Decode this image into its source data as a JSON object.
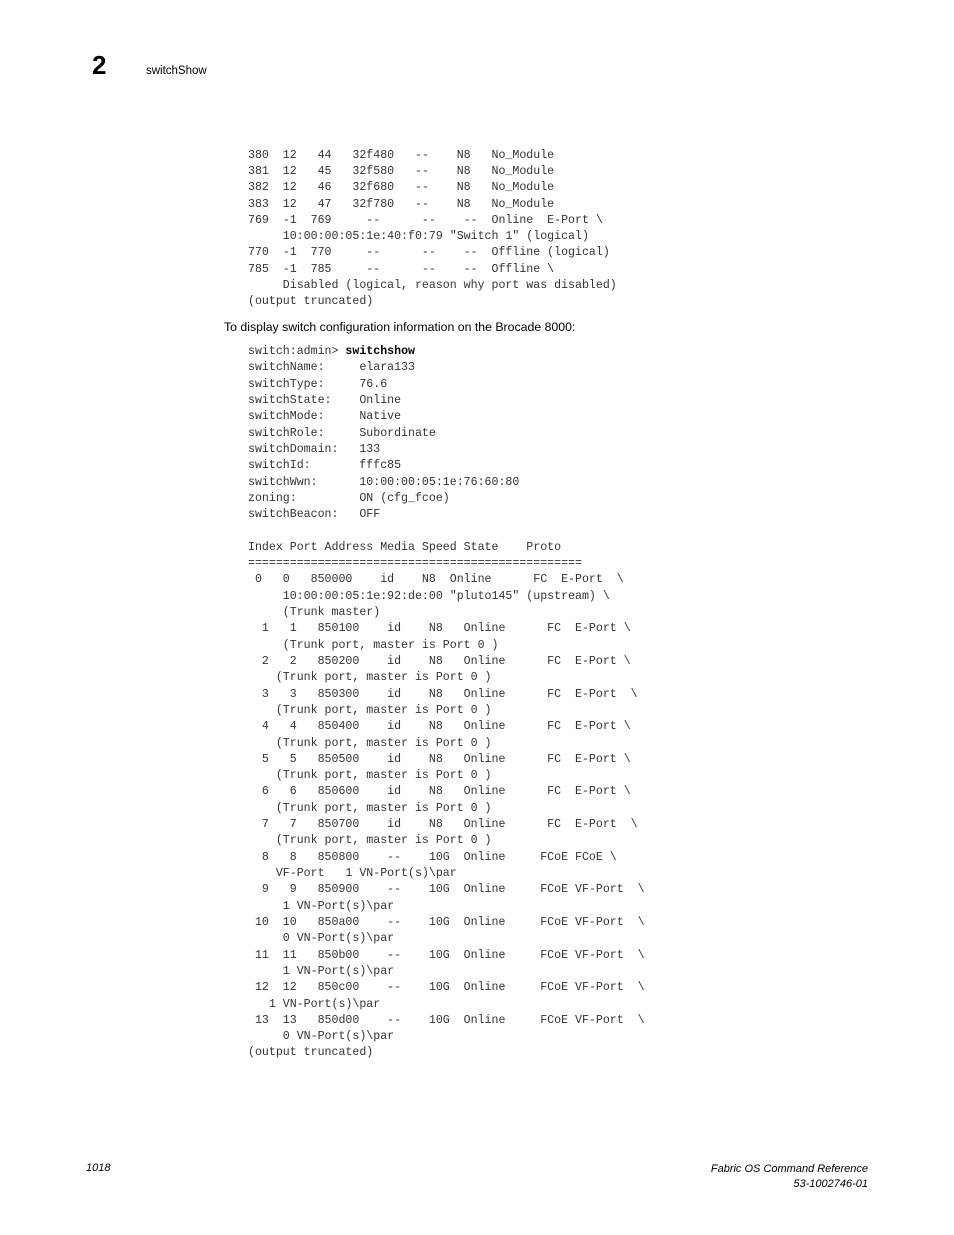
{
  "header": {
    "chapter_number": "2",
    "title": "switchShow"
  },
  "code_top": "380  12   44   32f480   --    N8   No_Module\n381  12   45   32f580   --    N8   No_Module\n382  12   46   32f680   --    N8   No_Module\n383  12   47   32f780   --    N8   No_Module\n769  -1  769     --      --    --  Online  E-Port \\\n     10:00:00:05:1e:40:f0:79 \"Switch 1\" (logical)\n770  -1  770     --      --    --  Offline (logical)\n785  -1  785     --      --    --  Offline \\\n     Disabled (logical, reason why port was disabled)\n(output truncated)",
  "body_paragraph": "To display switch configuration information on the Brocade 8000:",
  "prompt": {
    "prefix": "switch:admin> ",
    "command": "switchshow"
  },
  "switch_properties": [
    {
      "label": "switchName:",
      "value": "elara133"
    },
    {
      "label": "switchType:",
      "value": "76.6"
    },
    {
      "label": "switchState:",
      "value": "Online"
    },
    {
      "label": "switchMode:",
      "value": "Native"
    },
    {
      "label": "switchRole:",
      "value": "Subordinate"
    },
    {
      "label": "switchDomain:",
      "value": "133"
    },
    {
      "label": "switchId:",
      "value": "fffc85"
    },
    {
      "label": "switchWwn:",
      "value": "10:00:00:05:1e:76:60:80"
    },
    {
      "label": "zoning:",
      "value": "ON (cfg_fcoe)"
    },
    {
      "label": "switchBeacon:",
      "value": "OFF"
    }
  ],
  "port_table": {
    "headers": [
      "Index",
      "Port",
      "Address",
      "Media",
      "Speed",
      "State",
      "Proto"
    ],
    "header_line": "Index Port Address Media Speed State    Proto",
    "separator": "================================================",
    "rows": [
      {
        "index": "0",
        "port": "0",
        "address": "850000",
        "media": "id",
        "speed": "N8",
        "state": "Online",
        "proto": "FC",
        "type": "E-Port",
        "continuation": "10:00:00:05:1e:92:de:00 \"pluto145\" (upstream) \\",
        "continuation2": "(Trunk master)"
      },
      {
        "index": "1",
        "port": "1",
        "address": "850100",
        "media": "id",
        "speed": "N8",
        "state": "Online",
        "proto": "FC",
        "type": "E-Port",
        "continuation": "(Trunk port, master is Port 0 )"
      },
      {
        "index": "2",
        "port": "2",
        "address": "850200",
        "media": "id",
        "speed": "N8",
        "state": "Online",
        "proto": "FC",
        "type": "E-Port",
        "continuation": "(Trunk port, master is Port 0 )"
      },
      {
        "index": "3",
        "port": "3",
        "address": "850300",
        "media": "id",
        "speed": "N8",
        "state": "Online",
        "proto": "FC",
        "type": "E-Port",
        "continuation": "(Trunk port, master is Port 0 )"
      },
      {
        "index": "4",
        "port": "4",
        "address": "850400",
        "media": "id",
        "speed": "N8",
        "state": "Online",
        "proto": "FC",
        "type": "E-Port",
        "continuation": "(Trunk port, master is Port 0 )"
      },
      {
        "index": "5",
        "port": "5",
        "address": "850500",
        "media": "id",
        "speed": "N8",
        "state": "Online",
        "proto": "FC",
        "type": "E-Port",
        "continuation": "(Trunk port, master is Port 0 )"
      },
      {
        "index": "6",
        "port": "6",
        "address": "850600",
        "media": "id",
        "speed": "N8",
        "state": "Online",
        "proto": "FC",
        "type": "E-Port",
        "continuation": "(Trunk port, master is Port 0 )"
      },
      {
        "index": "7",
        "port": "7",
        "address": "850700",
        "media": "id",
        "speed": "N8",
        "state": "Online",
        "proto": "FC",
        "type": "E-Port",
        "continuation": "(Trunk port, master is Port 0 )"
      },
      {
        "index": "8",
        "port": "8",
        "address": "850800",
        "media": "--",
        "speed": "10G",
        "state": "Online",
        "proto": "FCoE",
        "type": "FCoE",
        "continuation": "VF-Port   1 VN-Port(s)\\par"
      },
      {
        "index": "9",
        "port": "9",
        "address": "850900",
        "media": "--",
        "speed": "10G",
        "state": "Online",
        "proto": "FCoE",
        "type": "VF-Port",
        "continuation": "1 VN-Port(s)\\par"
      },
      {
        "index": "10",
        "port": "10",
        "address": "850a00",
        "media": "--",
        "speed": "10G",
        "state": "Online",
        "proto": "FCoE",
        "type": "VF-Port",
        "continuation": "0 VN-Port(s)\\par"
      },
      {
        "index": "11",
        "port": "11",
        "address": "850b00",
        "media": "--",
        "speed": "10G",
        "state": "Online",
        "proto": "FCoE",
        "type": "VF-Port",
        "continuation": "1 VN-Port(s)\\par"
      },
      {
        "index": "12",
        "port": "12",
        "address": "850c00",
        "media": "--",
        "speed": "10G",
        "state": "Online",
        "proto": "FCoE",
        "type": "VF-Port",
        "continuation": "1 VN-Port(s)\\par"
      },
      {
        "index": "13",
        "port": "13",
        "address": "850d00",
        "media": "--",
        "speed": "10G",
        "state": "Online",
        "proto": "FCoE",
        "type": "VF-Port",
        "continuation": "0 VN-Port(s)\\par"
      }
    ],
    "truncated_note": "(output truncated)"
  },
  "code_bottom_body": "switchName:     elara133\nswitchType:     76.6\nswitchState:    Online\nswitchMode:     Native\nswitchRole:     Subordinate\nswitchDomain:   133\nswitchId:       fffc85\nswitchWwn:      10:00:00:05:1e:76:60:80\nzoning:         ON (cfg_fcoe)\nswitchBeacon:   OFF\n\nIndex Port Address Media Speed State    Proto\n================================================\n 0   0   850000    id    N8  Online      FC  E-Port  \\\n     10:00:00:05:1e:92:de:00 \"pluto145\" (upstream) \\\n     (Trunk master)\n  1   1   850100    id    N8   Online      FC  E-Port \\\n     (Trunk port, master is Port 0 )\n  2   2   850200    id    N8   Online      FC  E-Port \\\n    (Trunk port, master is Port 0 )\n  3   3   850300    id    N8   Online      FC  E-Port  \\\n    (Trunk port, master is Port 0 )\n  4   4   850400    id    N8   Online      FC  E-Port \\\n    (Trunk port, master is Port 0 )\n  5   5   850500    id    N8   Online      FC  E-Port \\\n    (Trunk port, master is Port 0 )\n  6   6   850600    id    N8   Online      FC  E-Port \\\n    (Trunk port, master is Port 0 )\n  7   7   850700    id    N8   Online      FC  E-Port  \\\n    (Trunk port, master is Port 0 )\n  8   8   850800    --    10G  Online     FCoE FCoE \\\n    VF-Port   1 VN-Port(s)\\par\n  9   9   850900    --    10G  Online     FCoE VF-Port  \\\n     1 VN-Port(s)\\par\n 10  10   850a00    --    10G  Online     FCoE VF-Port  \\\n     0 VN-Port(s)\\par\n 11  11   850b00    --    10G  Online     FCoE VF-Port  \\\n     1 VN-Port(s)\\par\n 12  12   850c00    --    10G  Online     FCoE VF-Port  \\\n   1 VN-Port(s)\\par\n 13  13   850d00    --    10G  Online     FCoE VF-Port  \\\n     0 VN-Port(s)\\par\n(output truncated)",
  "footer": {
    "page_number": "1018",
    "document_title": "Fabric OS Command Reference",
    "document_id": "53-1002746-01"
  }
}
